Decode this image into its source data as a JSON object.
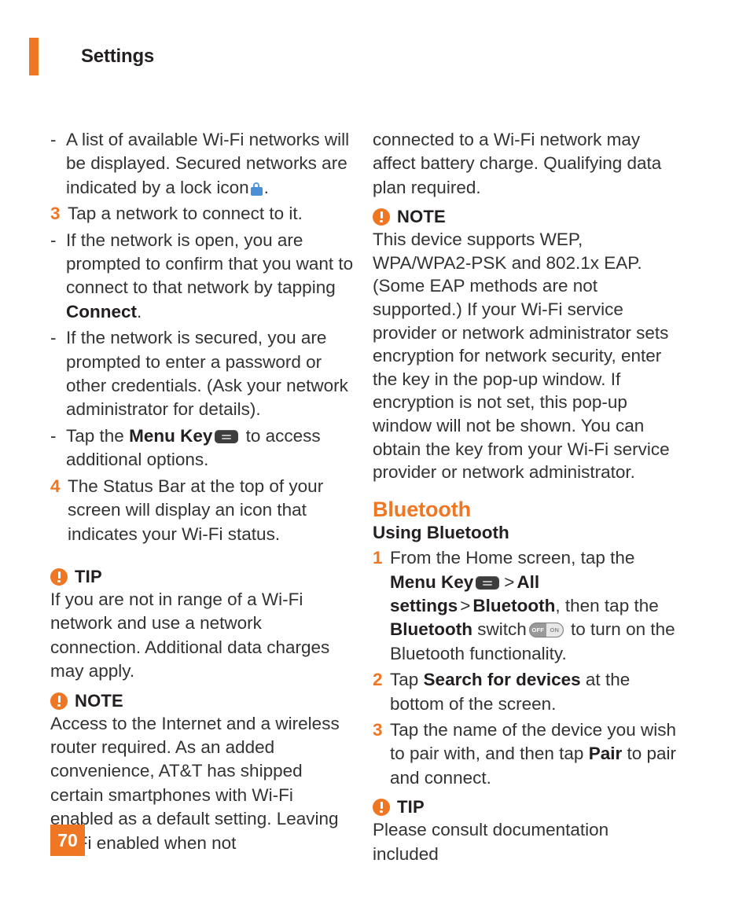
{
  "header": {
    "title": "Settings",
    "rule_color": "#ef7622"
  },
  "footer": {
    "page_number": "70",
    "background": "#ef7622"
  },
  "colors": {
    "accent": "#ef7622",
    "body_text": "#333333",
    "bold_text": "#231f20",
    "lock_icon": "#4a90d9",
    "menu_key": "#3d3d3d"
  },
  "left_column": {
    "item_dash_1": {
      "marker": "-",
      "text_before_icon": "A list of available Wi-Fi networks will be displayed. Secured networks are indicated by a lock icon",
      "icon": "lock-icon",
      "text_after_icon": "."
    },
    "item_3": {
      "marker": "3",
      "text": "Tap a network to connect to it."
    },
    "item_dash_2": {
      "marker": "-",
      "text_before_bold": "If the network is open, you are prompted to confirm that you want to connect to that network by tapping",
      "bold": "Connect",
      "text_after_bold": "."
    },
    "item_dash_3": {
      "marker": "-",
      "text": "If the network is secured, you are prompted to enter a password or other credentials. (Ask your network administrator for details)."
    },
    "item_dash_4": {
      "marker": "-",
      "text_before_bold": "Tap the",
      "bold": "Menu Key",
      "icon": "menu-key-icon",
      "text_after_icon": "to access additional options."
    },
    "item_4": {
      "marker": "4",
      "text": "The Status Bar at the top of your screen will display an icon that  indicates your Wi-Fi status."
    },
    "tip": {
      "icon": "warning-icon",
      "label": "TIP",
      "body": "If you are not in range of a Wi-Fi network and use a network connection. Additional data charges may apply."
    },
    "note": {
      "icon": "warning-icon",
      "label": "NOTE",
      "body": "Access to the Internet and a wireless router required. As an added convenience, AT&T has shipped certain smartphones with Wi-Fi enabled as a default setting. Leaving Wi-Fi enabled when not"
    }
  },
  "right_column": {
    "continued_paragraph": "connected to a Wi-Fi network may affect battery charge. Qualifying data plan required.",
    "note": {
      "icon": "warning-icon",
      "label": "NOTE",
      "body": "This device supports WEP, WPA/WPA2-PSK and 802.1x EAP. (Some EAP methods are not supported.) If your Wi-Fi service provider or network administrator sets encryption for network security, enter the key in the pop-up window. If encryption is not set, this pop-up window will not be shown. You can obtain the key from your Wi-Fi service provider or network administrator."
    },
    "section_title": "Bluetooth",
    "subsection_title": "Using Bluetooth",
    "item_1": {
      "marker": "1",
      "seg_1": "From the Home screen, tap the",
      "bold_1": "Menu Key",
      "icon_1": "menu-key-icon",
      "sep_1": ">",
      "bold_2": "All settings",
      "sep_2": ">",
      "bold_3": "Bluetooth",
      "seg_2": ", then tap the",
      "bold_4": "Bluetooth",
      "seg_3": "switch",
      "icon_2": "toggle-switch-icon",
      "seg_4": "to turn on the Bluetooth functionality."
    },
    "item_2": {
      "marker": "2",
      "seg_1": "Tap",
      "bold_1": "Search for devices",
      "seg_2": "at the bottom of the screen."
    },
    "item_3": {
      "marker": "3",
      "seg_1": "Tap the name of the device you wish to pair with, and then tap",
      "bold_1": "Pair",
      "seg_2": "to pair and connect."
    },
    "tip": {
      "icon": "warning-icon",
      "label": "TIP",
      "body": "Please consult documentation included"
    }
  },
  "icons": {
    "toggle_off_label": "OFF",
    "toggle_on_label": "ON"
  }
}
